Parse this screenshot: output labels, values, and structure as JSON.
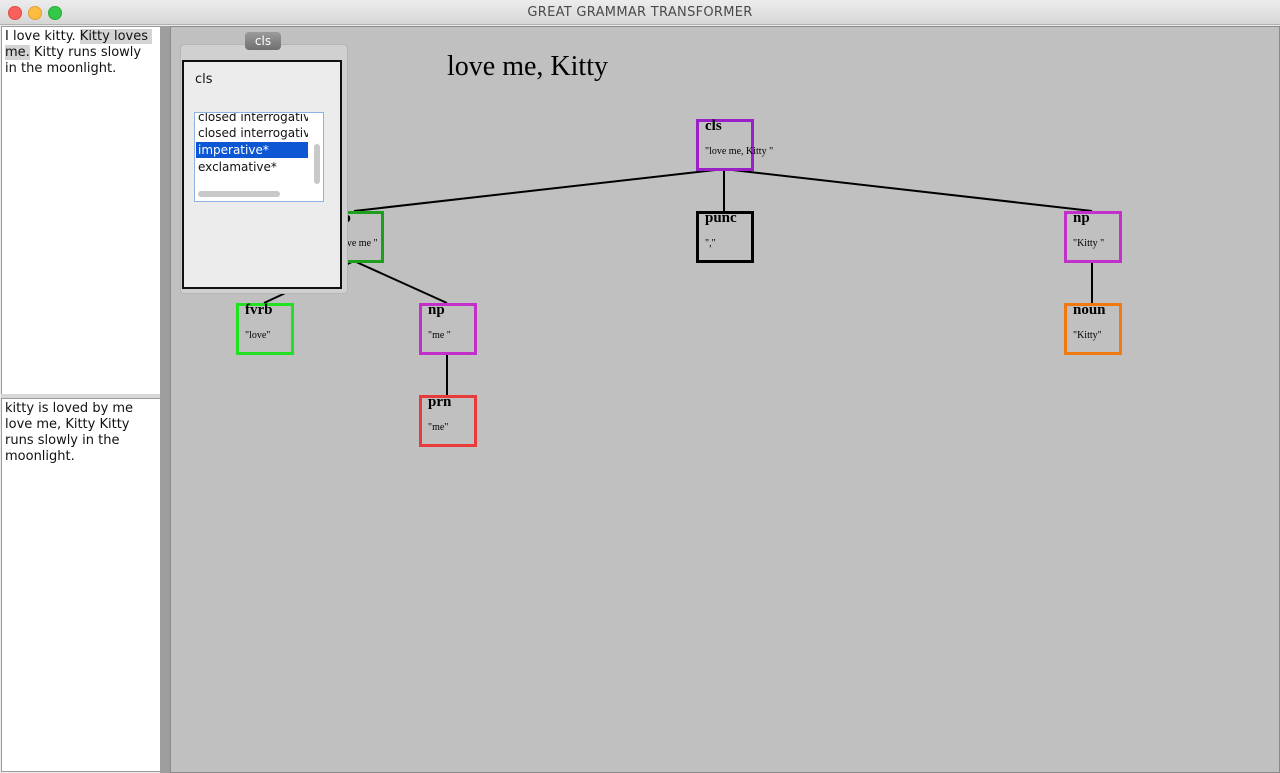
{
  "window": {
    "title": "GREAT GRAMMAR TRANSFORMER"
  },
  "input_pane": {
    "text_segments": [
      {
        "text": "I love kitty. ",
        "highlight": false
      },
      {
        "text": "Kitty loves me.",
        "highlight": true
      },
      {
        "text": " Kitty runs slowly in the moonlight.",
        "highlight": false
      }
    ]
  },
  "output_pane": {
    "text": "kitty is loved by me\nlove me, Kitty Kitty runs slowly in the moonlight."
  },
  "canvas": {
    "sentence": "love me, Kitty",
    "nodes": [
      {
        "id": "cls",
        "label": "cls",
        "text": "\"love me, Kitty \"",
        "color": "#9b1fc9"
      },
      {
        "id": "vp",
        "label": "vp",
        "text": "\"love me \"",
        "color": "#1e9e1e"
      },
      {
        "id": "punc",
        "label": "punc",
        "text": "\",\"",
        "color": "#000000"
      },
      {
        "id": "np1",
        "label": "np",
        "text": "\"Kitty \"",
        "color": "#c330c9"
      },
      {
        "id": "fvrb",
        "label": "fvrb",
        "text": "\"love\"",
        "color": "#22e022"
      },
      {
        "id": "np2",
        "label": "np",
        "text": "\"me \"",
        "color": "#c330c9"
      },
      {
        "id": "noun",
        "label": "noun",
        "text": "\"Kitty\"",
        "color": "#f07a10"
      },
      {
        "id": "prn",
        "label": "prn",
        "text": "\"me\"",
        "color": "#e83a3a"
      }
    ]
  },
  "popup": {
    "tab_label": "cls",
    "heading": "cls",
    "list_items": [
      {
        "label": "closed interrogative",
        "selected": false
      },
      {
        "label": "closed interrogative",
        "selected": false
      },
      {
        "label": "imperative*",
        "selected": true
      },
      {
        "label": "exclamative*",
        "selected": false
      }
    ]
  }
}
